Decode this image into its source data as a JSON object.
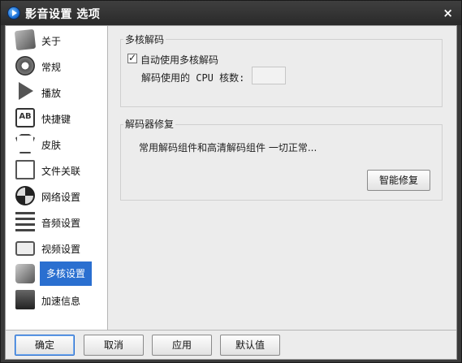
{
  "window": {
    "title": "影音设置 选项",
    "close_glyph": "×"
  },
  "sidebar": {
    "items": [
      {
        "label": "关于",
        "icon": "about-icon"
      },
      {
        "label": "常规",
        "icon": "gear-icon"
      },
      {
        "label": "播放",
        "icon": "play-icon"
      },
      {
        "label": "快捷键",
        "icon": "keyboard-ab-icon"
      },
      {
        "label": "皮肤",
        "icon": "shirt-icon"
      },
      {
        "label": "文件关联",
        "icon": "file-icon"
      },
      {
        "label": "网络设置",
        "icon": "network-icon"
      },
      {
        "label": "音频设置",
        "icon": "audio-icon"
      },
      {
        "label": "视频设置",
        "icon": "tv-icon"
      },
      {
        "label": "多核设置",
        "icon": "multicore-icon",
        "active": true
      },
      {
        "label": "加速信息",
        "icon": "speed-icon"
      }
    ]
  },
  "main": {
    "multicore_group": {
      "title": "多核解码",
      "checkbox_label": "自动使用多核解码",
      "checkbox_checked": true,
      "cpu_label": "解码使用的 CPU 核数:",
      "cpu_value": ""
    },
    "decoder_group": {
      "title": "解码器修复",
      "status": "常用解码组件和高清解码组件 一切正常...",
      "repair_button": "智能修复"
    }
  },
  "footer": {
    "ok": "确定",
    "cancel": "取消",
    "apply": "应用",
    "defaults": "默认值"
  },
  "colors": {
    "accent": "#2a6fd0",
    "titlebar": "#2e2e2e",
    "panel": "#ececec"
  }
}
